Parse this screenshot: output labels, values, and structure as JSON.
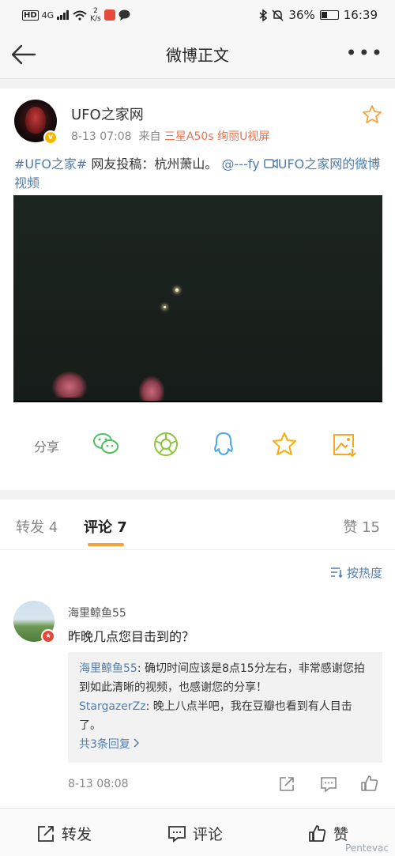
{
  "status_bar": {
    "network_badge": "HD",
    "network_gen": "4G",
    "speed_value": "2",
    "speed_unit": "K/s",
    "battery": "36%",
    "time": "16:39"
  },
  "nav": {
    "title": "微博正文",
    "more": "•••"
  },
  "post": {
    "username": "UFO之家网",
    "timestamp": "8-13 07:08",
    "source_prefix": "来自",
    "source": "三星A50s 绚丽U视屏",
    "hashtag": "#UFO之家#",
    "text": " 网友投稿：杭州萧山。",
    "mention": "@---fy",
    "video_link": "UFO之家网的微博视频",
    "share_label": "分享"
  },
  "tabs": {
    "repost": "转发 4",
    "comment": "评论 7",
    "like": "赞 15"
  },
  "comments": {
    "sort_label": "按热度",
    "items": [
      {
        "name": "海里鲸鱼55",
        "text": "昨晚几点您目击到的？",
        "replies": [
          {
            "name": "海里鲸鱼55",
            "text": ": 确切时间应该是8点15分左右，非常感谢您拍到如此清晰的视频，也感谢您的分享！"
          },
          {
            "name": "StargazerZz",
            "text": ": 晚上八点半吧，我在豆瓣也看到有人目击了。"
          }
        ],
        "more_replies": "共3条回复",
        "time": "8-13 08:08"
      }
    ]
  },
  "bottom_bar": {
    "repost": "转发",
    "comment": "评论",
    "like": "赞"
  },
  "watermark": "Pentevac",
  "colors": {
    "link": "#507daf",
    "accent": "#f4a23a",
    "source": "#eb7350"
  }
}
